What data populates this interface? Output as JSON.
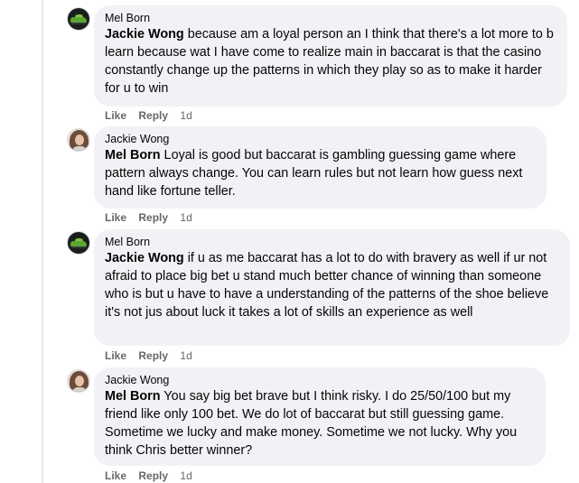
{
  "comments": [
    {
      "author": "Mel Born",
      "mention": "Jackie Wong",
      "body": " because am a loyal person an I think that there's a lot more to b learn because wat I have come to realize main in baccarat is that the casino constantly change up the patterns in which they play so as to make it harder for u to win",
      "like": "Like",
      "reply": "Reply",
      "time": "1d"
    },
    {
      "author": "Jackie Wong",
      "mention": "Mel Born",
      "body": " Loyal is good but baccarat is gambling guessing game where pattern always change. You can learn rules but not learn how guess next hand like fortune teller.",
      "like": "Like",
      "reply": "Reply",
      "time": "1d"
    },
    {
      "author": "Mel Born",
      "mention": "Jackie Wong",
      "body": " if u as me baccarat has a lot to do with bravery as well if ur not afraid to place big bet u stand much better chance of winning than someone who is but u have to have a understanding of the patterns of the shoe believe it's not jus about luck it takes a lot of skills an experience as well",
      "like": "Like",
      "reply": "Reply",
      "time": "1d"
    },
    {
      "author": "Jackie Wong",
      "mention": "Mel Born",
      "body": " You say big bet brave but I think risky. I do 25/50/100 but my friend like only 100 bet. We do lot of baccarat but still guessing game. Sometime we lucky and make money. Sometime we not lucky. Why you think Chris better winner?",
      "like": "Like",
      "reply": "Reply",
      "time": "1d"
    }
  ]
}
